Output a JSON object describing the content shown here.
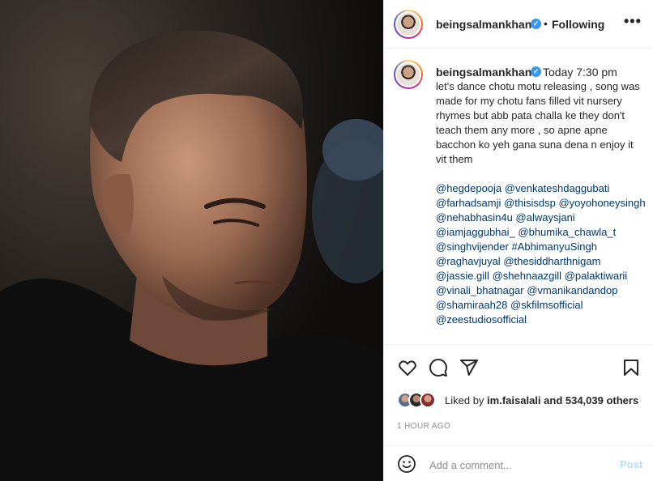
{
  "header": {
    "username": "beingsalmankhan",
    "verified_icon": "verified-badge-icon",
    "separator": "•",
    "follow_status": "Following",
    "more_label": "•••"
  },
  "caption": {
    "username": "beingsalmankhan",
    "time": "Today 7:30 pm",
    "text": "let's dance chotu motu releasing , song was made for my chotu fans filled vit nursery rhymes but abb pata challa ke they don't teach them any more , so apne apne bacchon ko yeh gana suna dena n enjoy it vit them",
    "tags": [
      "@hegdepooja",
      "@venkateshdaggubati",
      "@farhadsamji",
      "@thisisdsp",
      "@yoyohoneysingh",
      "@nehabhasin4u",
      "@alwaysjani",
      "@iamjaggubhai_",
      "@bhumika_chawla_t",
      "@singhvijender",
      "#AbhimanyuSingh",
      "@raghavjuyal",
      "@thesiddharthnigam",
      "@jassie.gill",
      "@shehnaazgill",
      "@palaktiwarii",
      "@vinali_bhatnagar",
      "@vmanikandandop",
      "@shamiraah28",
      "@skfilmsofficial",
      "@zeestudiosofficial"
    ]
  },
  "actions": {
    "icons": [
      "heart-icon",
      "comment-icon",
      "share-icon",
      "bookmark-icon"
    ]
  },
  "likes": {
    "prefix": "Liked by ",
    "user": "im.faisalali",
    "suffix": " and 534,039 others"
  },
  "time_ago": "1 HOUR AGO",
  "comment": {
    "placeholder": "Add a comment...",
    "post_label": "Post"
  },
  "colors": {
    "link": "#00376b",
    "verified": "#3897f0",
    "post_disabled": "#b2dffc",
    "muted": "#8e8e8e"
  }
}
